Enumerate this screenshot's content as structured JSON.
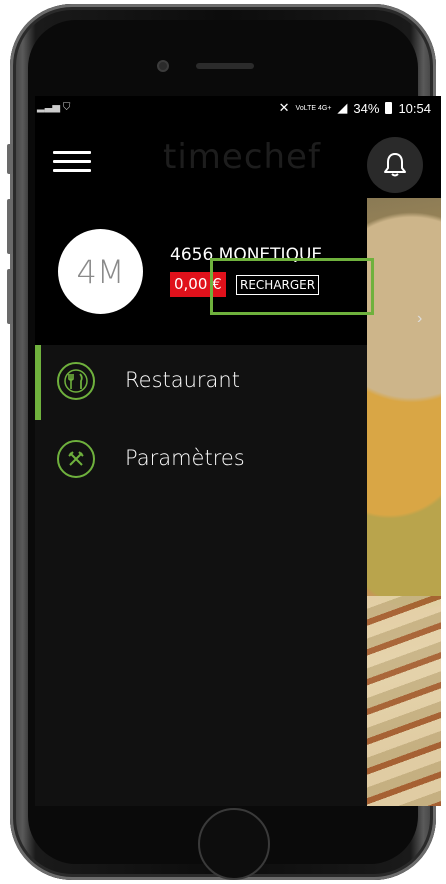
{
  "status_bar": {
    "left_icons": "signal shield",
    "indicators": "VoLTE 4G+",
    "battery": "34%",
    "time": "10:54"
  },
  "app": {
    "brand": "timechef"
  },
  "drawer": {
    "avatar_initials": "4M",
    "account_name": "4656 MONETIQUE",
    "balance": "0,00 €",
    "recharge_label": "RECHARGER",
    "menu": [
      {
        "label": "Restaurant",
        "icon": "restaurant-icon",
        "active": true
      },
      {
        "label": "Paramètres",
        "icon": "tools-icon",
        "active": false
      }
    ]
  },
  "colors": {
    "accent": "#6fb13d",
    "balance_bg": "#e0111b",
    "drawer_bg": "#111111"
  }
}
